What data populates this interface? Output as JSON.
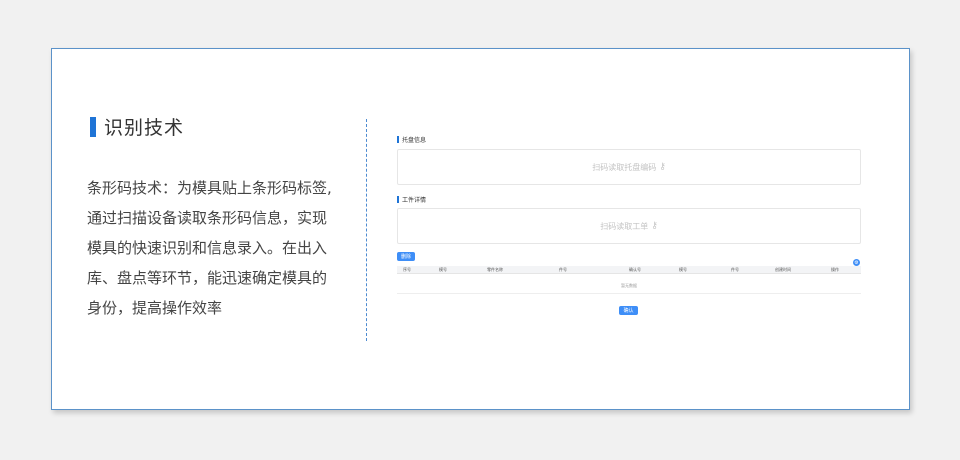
{
  "section_title": "识别技术",
  "description_lines": [
    "条形码技术：为模具贴上条形码标签,",
    "通过扫描设备读取条形码信息，实现",
    "模具的快速识别和信息录入。在出入",
    "库、盘点等环节，能迅速确定模具的",
    "身份，提高操作效率"
  ],
  "screenshot": {
    "tray_section_label": "托盘信息",
    "tray_scan_placeholder": "扫码读取托盘编码",
    "work_section_label": "工件详情",
    "work_scan_placeholder": "扫码读取工单",
    "key_icon": "key-icon",
    "delete_button": "删除",
    "table_headers": [
      "序号",
      "模号",
      "零件名称",
      "件号",
      "确认号",
      "模号",
      "件号",
      "创建时间",
      "操作"
    ],
    "empty_text": "暂无数据",
    "confirm_button": "确认",
    "accent_color": "#3e8ef7"
  }
}
